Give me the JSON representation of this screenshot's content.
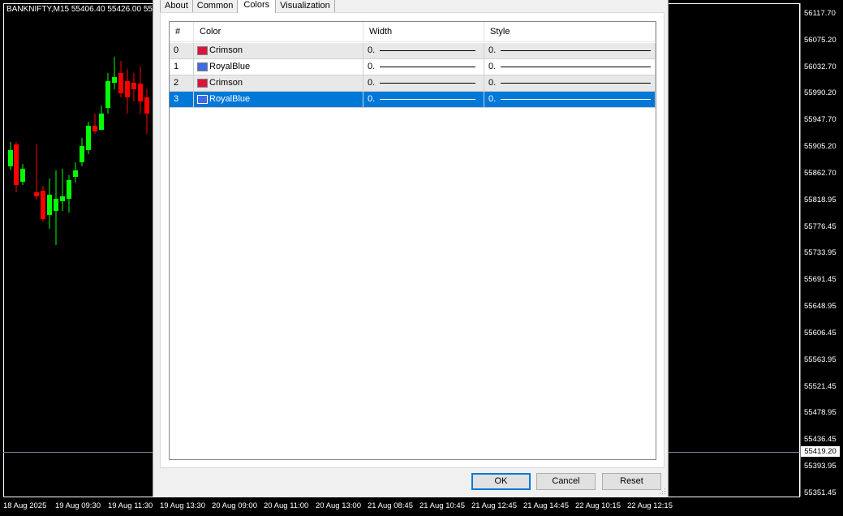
{
  "chart": {
    "title": "BANKNIFTY,M15  55406.40 55426.00 55",
    "price_labels": [
      "56117.70",
      "56075.20",
      "56032.70",
      "55990.20",
      "55947.70",
      "55905.20",
      "55862.70",
      "55818.95",
      "55776.45",
      "55733.95",
      "55691.45",
      "55648.95",
      "55606.45",
      "55563.95",
      "55521.45",
      "55478.95",
      "55436.45",
      "55393.95",
      "55351.45"
    ],
    "current_price": "55419.20",
    "time_labels": [
      "18 Aug 2025",
      "19 Aug 09:30",
      "19 Aug 11:30",
      "19 Aug 13:30",
      "20 Aug 09:00",
      "20 Aug 11:00",
      "20 Aug 13:00",
      "21 Aug 08:45",
      "21 Aug 10:45",
      "21 Aug 12:45",
      "21 Aug 14:45",
      "22 Aug 10:15",
      "22 Aug 12:15"
    ],
    "colors": {
      "bull": "#00ff00",
      "bear": "#ff0000",
      "background": "#000000",
      "text": "#ffffff"
    }
  },
  "dialog": {
    "tabs": [
      "About",
      "Common",
      "Colors",
      "Visualization"
    ],
    "active_tab": "Colors",
    "columns": [
      "#",
      "Color",
      "Width",
      "Style"
    ],
    "rows": [
      {
        "index": "0",
        "color_name": "Crimson",
        "color": "#dc143c",
        "width": "0.",
        "style": "0."
      },
      {
        "index": "1",
        "color_name": "RoyalBlue",
        "color": "#4169e1",
        "width": "0.",
        "style": "0."
      },
      {
        "index": "2",
        "color_name": "Crimson",
        "color": "#dc143c",
        "width": "0.",
        "style": "0."
      },
      {
        "index": "3",
        "color_name": "RoyalBlue",
        "color": "#4169e1",
        "width": "0.",
        "style": "0."
      }
    ],
    "selected_row": 3,
    "buttons": {
      "ok": "OK",
      "cancel": "Cancel",
      "reset": "Reset"
    }
  }
}
